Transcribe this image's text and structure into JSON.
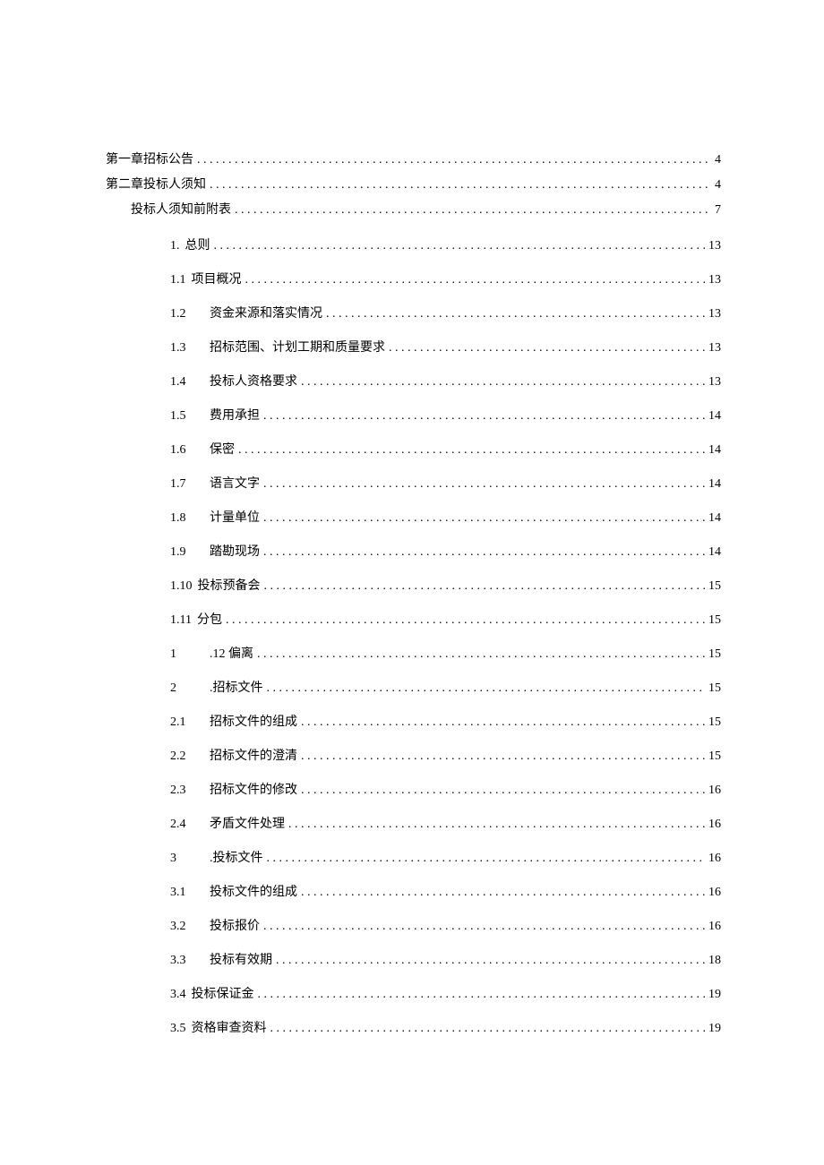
{
  "toc": [
    {
      "cls": "top1",
      "num": "",
      "label": "第一章招标公告",
      "page": "4"
    },
    {
      "cls": "top2",
      "num": "",
      "label": "第二章投标人须知",
      "page": "4"
    },
    {
      "cls": "sub1",
      "num": "",
      "label": "投标人须知前附表",
      "page": "7"
    },
    {
      "cls": "sub2",
      "num": "1.",
      "label": "总则",
      "page": "13",
      "tight": true
    },
    {
      "cls": "sub2",
      "num": "1.1",
      "label": "项目概况",
      "page": "13",
      "tight": true
    },
    {
      "cls": "sub2",
      "num": "1.2",
      "label": "资金来源和落实情况",
      "page": "13"
    },
    {
      "cls": "sub2",
      "num": "1.3",
      "label": "招标范围、计划工期和质量要求",
      "page": "13"
    },
    {
      "cls": "sub2",
      "num": "1.4",
      "label": "投标人资格要求",
      "page": "13"
    },
    {
      "cls": "sub2",
      "num": "1.5",
      "label": "费用承担",
      "page": "14"
    },
    {
      "cls": "sub2",
      "num": "1.6",
      "label": "保密",
      "page": "14"
    },
    {
      "cls": "sub2",
      "num": "1.7",
      "label": "语言文字",
      "page": "14"
    },
    {
      "cls": "sub2",
      "num": "1.8",
      "label": "计量单位",
      "page": "14"
    },
    {
      "cls": "sub2",
      "num": "1.9",
      "label": "踏勘现场",
      "page": "14"
    },
    {
      "cls": "sub2",
      "num": "1.10",
      "label": "投标预备会",
      "page": "15",
      "tight": true
    },
    {
      "cls": "sub2",
      "num": "1.11",
      "label": "分包",
      "page": "15",
      "tight": true
    },
    {
      "cls": "sub2",
      "num": "1",
      "label": ".12 偏离",
      "page": "15"
    },
    {
      "cls": "sub2",
      "num": "2",
      "label": ".招标文件",
      "page": "15"
    },
    {
      "cls": "sub2",
      "num": "2.1",
      "label": "招标文件的组成",
      "page": "15"
    },
    {
      "cls": "sub2",
      "num": "2.2",
      "label": "招标文件的澄清",
      "page": "15"
    },
    {
      "cls": "sub2",
      "num": "2.3",
      "label": "招标文件的修改",
      "page": "16"
    },
    {
      "cls": "sub2",
      "num": "2.4",
      "label": "矛盾文件处理",
      "page": "16"
    },
    {
      "cls": "sub2",
      "num": "3",
      "label": ".投标文件",
      "page": "16"
    },
    {
      "cls": "sub2",
      "num": "3.1",
      "label": "投标文件的组成",
      "page": "16"
    },
    {
      "cls": "sub2",
      "num": "3.2",
      "label": "投标报价",
      "page": "16"
    },
    {
      "cls": "sub2",
      "num": "3.3",
      "label": "投标有效期",
      "page": "18"
    },
    {
      "cls": "sub2",
      "num": "3.4",
      "label": "投标保证金",
      "page": "19",
      "tight": true
    },
    {
      "cls": "sub2",
      "num": "3.5",
      "label": "资格审查资料",
      "page": "19",
      "tight": true
    }
  ]
}
